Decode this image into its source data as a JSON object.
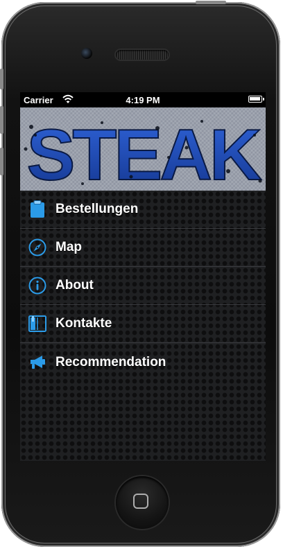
{
  "status_bar": {
    "carrier": "Carrier",
    "time": "4:19 PM",
    "wifi_icon": "wifi-icon",
    "battery_icon": "battery-icon"
  },
  "banner": {
    "logo_text": "STEAK"
  },
  "menu": {
    "items": [
      {
        "label": "Bestellungen",
        "icon": "clipboard-icon"
      },
      {
        "label": "Map",
        "icon": "compass-icon"
      },
      {
        "label": "About",
        "icon": "info-icon"
      },
      {
        "label": "Kontakte",
        "icon": "address-book-icon"
      },
      {
        "label": "Recommendation",
        "icon": "megaphone-icon"
      }
    ]
  },
  "colors": {
    "accent_blue": "#2b9be8",
    "logo_blue": "#1d49b8",
    "menu_background": "#1f2022",
    "divider": "#3b3c40"
  }
}
